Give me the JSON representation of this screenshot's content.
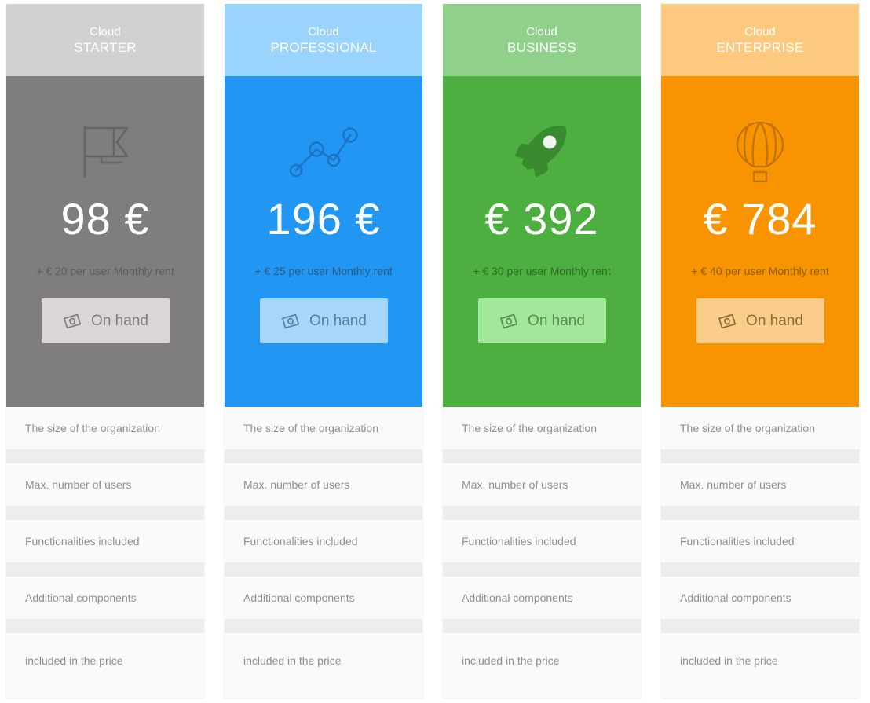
{
  "plans": [
    {
      "kicker": "Cloud",
      "name": "STARTER",
      "icon": "flag-icon",
      "price": "98 €",
      "subprice": "+ € 20 per user Monthly rent",
      "cta_label": "On hand",
      "cta_icon": "banknote-icon",
      "header_bg": "#d3d0d1",
      "body_bg": "#7f7d7d",
      "cta_bg": "#dad6d7",
      "cta_text": "#7f7d7d",
      "icon_color": "#666465",
      "subprice_color": "#5e5c5c"
    },
    {
      "kicker": "Cloud",
      "name": "PROFESSIONAL",
      "icon": "line-chart-icon",
      "price": "196 €",
      "subprice": "+ € 25 per user Monthly rent",
      "cta_label": "On hand",
      "cta_icon": "banknote-icon",
      "header_bg": "#9ad3fc",
      "body_bg": "#2196f3",
      "cta_bg": "#a6d6fb",
      "cta_text": "#5a7f9c",
      "icon_color": "#1b74c0",
      "subprice_color": "#2d5c80"
    },
    {
      "kicker": "Cloud",
      "name": "BUSINESS",
      "icon": "rocket-icon",
      "price": "€ 392",
      "subprice": "+ € 30 per user Monthly rent",
      "cta_label": "On hand",
      "cta_icon": "banknote-icon",
      "header_bg": "#8fd18a",
      "body_bg": "#4caf3f",
      "cta_bg": "#a2e89b",
      "cta_text": "#5a8a53",
      "icon_color": "#3a8a30",
      "subprice_color": "#2f6b27"
    },
    {
      "kicker": "Cloud",
      "name": "ENTERPRISE",
      "icon": "hot-air-balloon-icon",
      "price": "€ 784",
      "subprice": "+ € 40 per user Monthly rent",
      "cta_label": "On hand",
      "cta_icon": "banknote-icon",
      "header_bg": "#fcc97f",
      "body_bg": "#f79400",
      "cta_bg": "#fbcd8b",
      "cta_text": "#8d6a34",
      "icon_color": "#c07400",
      "subprice_color": "#8a5f09"
    }
  ],
  "features": [
    "The size of the organization",
    "Max. number of users",
    "Functionalities included",
    "Additional components",
    "included in the price"
  ]
}
